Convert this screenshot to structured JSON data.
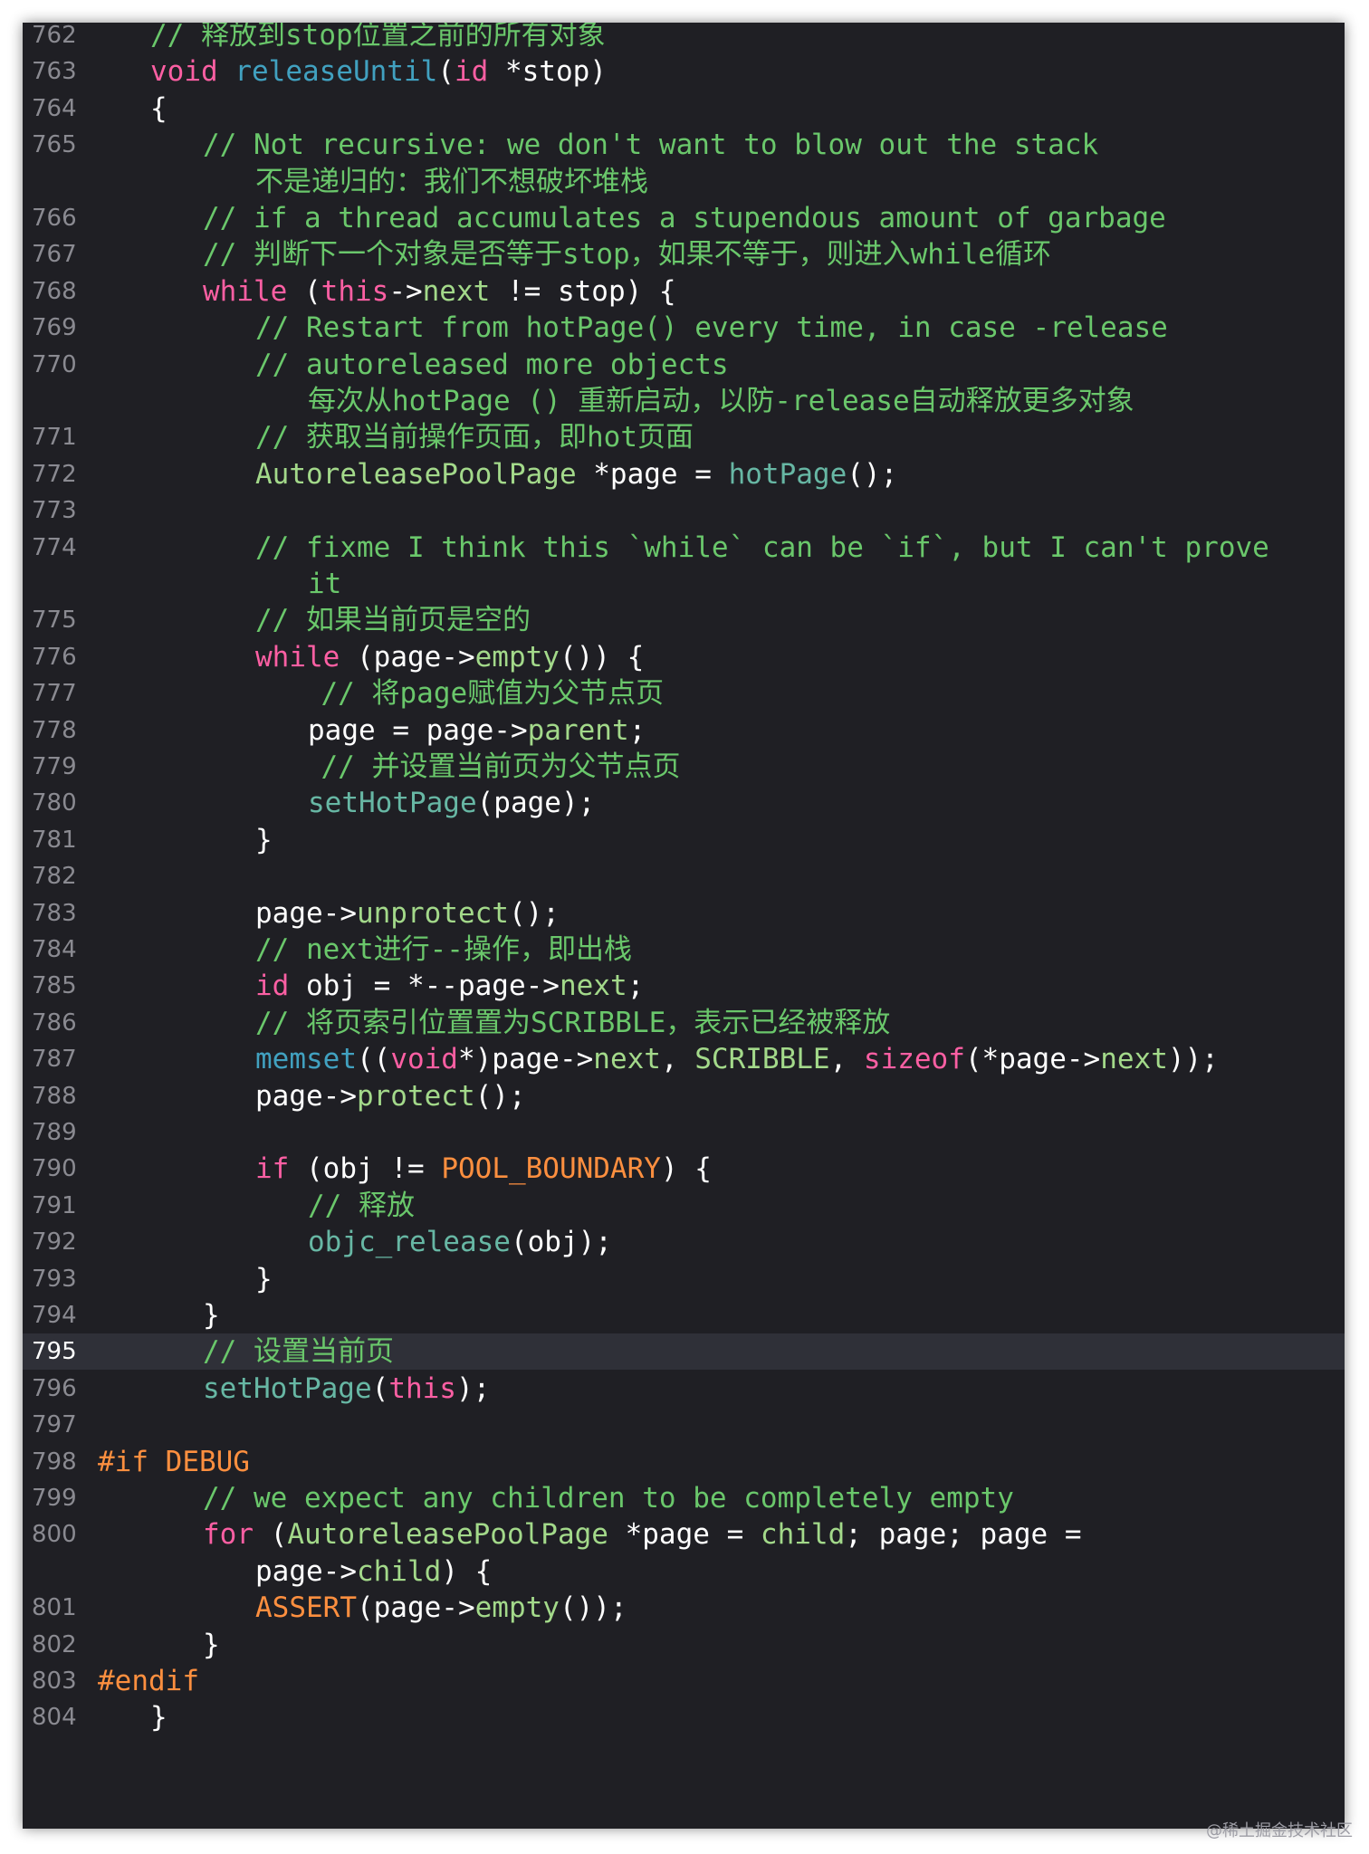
{
  "editor": {
    "current_line": "795",
    "watermark": "@稀土掘金技术社区"
  },
  "colors": {
    "background": "#1f1f24",
    "line_number": "#8a8a91",
    "current_line_bg": "#2f3038",
    "comment": "#6ac76b",
    "keyword": "#fc5fa3",
    "function": "#67b7a4",
    "type": "#a3d98a",
    "preprocessor": "#fd8f3f",
    "plain": "#ffffff"
  },
  "lines": [
    {
      "n": "762",
      "indent": 2,
      "tokens": [
        [
          "// 释放到stop位置之前的所有对象",
          "cm"
        ]
      ]
    },
    {
      "n": "763",
      "indent": 2,
      "tokens": [
        [
          "void",
          "kw"
        ],
        [
          " ",
          "tx"
        ],
        [
          "releaseUntil",
          "df"
        ],
        [
          "(",
          "tx"
        ],
        [
          "id",
          "kw"
        ],
        [
          " *stop)",
          "tx"
        ]
      ]
    },
    {
      "n": "764",
      "indent": 2,
      "tokens": [
        [
          "{",
          "tx"
        ]
      ]
    },
    {
      "n": "765",
      "indent": 4,
      "tokens": [
        [
          "// Not recursive: we don't want to blow out the stack",
          "cm"
        ]
      ]
    },
    {
      "n": "",
      "indent": 6,
      "tokens": [
        [
          "不是递归的：我们不想破坏堆栈",
          "cm"
        ]
      ]
    },
    {
      "n": "766",
      "indent": 4,
      "tokens": [
        [
          "// if a thread accumulates a stupendous amount of garbage",
          "cm"
        ]
      ]
    },
    {
      "n": "767",
      "indent": 4,
      "tokens": [
        [
          "// 判断下一个对象是否等于stop，如果不等于，则进入while循环",
          "cm"
        ]
      ]
    },
    {
      "n": "768",
      "indent": 4,
      "tokens": [
        [
          "while",
          "kw"
        ],
        [
          " (",
          "tx"
        ],
        [
          "this",
          "kw"
        ],
        [
          "->",
          "tx"
        ],
        [
          "next",
          "ty"
        ],
        [
          " != stop) {",
          "tx"
        ]
      ]
    },
    {
      "n": "769",
      "indent": 6,
      "tokens": [
        [
          "// Restart from hotPage() every time, in case -release",
          "cm"
        ]
      ]
    },
    {
      "n": "770",
      "indent": 6,
      "tokens": [
        [
          "// autoreleased more objects",
          "cm"
        ]
      ]
    },
    {
      "n": "",
      "indent": 8,
      "tokens": [
        [
          "每次从hotPage () 重新启动，以防-release自动释放更多对象",
          "cm"
        ]
      ]
    },
    {
      "n": "771",
      "indent": 6,
      "tokens": [
        [
          "// 获取当前操作页面，即hot页面",
          "cm"
        ]
      ]
    },
    {
      "n": "772",
      "indent": 6,
      "tokens": [
        [
          "AutoreleasePoolPage",
          "ty"
        ],
        [
          " *page = ",
          "tx"
        ],
        [
          "hotPage",
          "fn"
        ],
        [
          "();",
          "tx"
        ]
      ]
    },
    {
      "n": "773",
      "indent": 0,
      "tokens": []
    },
    {
      "n": "774",
      "indent": 6,
      "tokens": [
        [
          "// fixme I think this `while` can be `if`, but I can't prove",
          "cm"
        ]
      ]
    },
    {
      "n": "",
      "indent": 8,
      "tokens": [
        [
          "it",
          "cm"
        ]
      ]
    },
    {
      "n": "775",
      "indent": 6,
      "tokens": [
        [
          "// 如果当前页是空的",
          "cm"
        ]
      ]
    },
    {
      "n": "776",
      "indent": 6,
      "tokens": [
        [
          "while",
          "kw"
        ],
        [
          " (page->",
          "tx"
        ],
        [
          "empty",
          "ty"
        ],
        [
          "()) {",
          "tx"
        ]
      ]
    },
    {
      "n": "777",
      "indent": 8.5,
      "tokens": [
        [
          "// 将page赋值为父节点页",
          "cm"
        ]
      ]
    },
    {
      "n": "778",
      "indent": 8,
      "tokens": [
        [
          "page = page->",
          "tx"
        ],
        [
          "parent",
          "ty"
        ],
        [
          ";",
          "tx"
        ]
      ]
    },
    {
      "n": "779",
      "indent": 8.5,
      "tokens": [
        [
          "// 并设置当前页为父节点页",
          "cm"
        ]
      ]
    },
    {
      "n": "780",
      "indent": 8,
      "tokens": [
        [
          "setHotPage",
          "fn"
        ],
        [
          "(page);",
          "tx"
        ]
      ]
    },
    {
      "n": "781",
      "indent": 6,
      "tokens": [
        [
          "}",
          "tx"
        ]
      ]
    },
    {
      "n": "782",
      "indent": 0,
      "tokens": []
    },
    {
      "n": "783",
      "indent": 6,
      "tokens": [
        [
          "page->",
          "tx"
        ],
        [
          "unprotect",
          "ty"
        ],
        [
          "();",
          "tx"
        ]
      ]
    },
    {
      "n": "784",
      "indent": 6,
      "tokens": [
        [
          "// next进行--操作，即出栈",
          "cm"
        ]
      ]
    },
    {
      "n": "785",
      "indent": 6,
      "tokens": [
        [
          "id",
          "kw"
        ],
        [
          " obj = *--page->",
          "tx"
        ],
        [
          "next",
          "ty"
        ],
        [
          ";",
          "tx"
        ]
      ]
    },
    {
      "n": "786",
      "indent": 6,
      "tokens": [
        [
          "// 将页索引位置置为SCRIBBLE，表示已经被释放",
          "cm"
        ]
      ]
    },
    {
      "n": "787",
      "indent": 6,
      "tokens": [
        [
          "memset",
          "df"
        ],
        [
          "((",
          "tx"
        ],
        [
          "void",
          "kw"
        ],
        [
          "*)page->",
          "tx"
        ],
        [
          "next",
          "ty"
        ],
        [
          ", ",
          "tx"
        ],
        [
          "SCRIBBLE",
          "ty"
        ],
        [
          ", ",
          "tx"
        ],
        [
          "sizeof",
          "kw"
        ],
        [
          "(*page->",
          "tx"
        ],
        [
          "next",
          "ty"
        ],
        [
          "));",
          "tx"
        ]
      ]
    },
    {
      "n": "788",
      "indent": 6,
      "tokens": [
        [
          "page->",
          "tx"
        ],
        [
          "protect",
          "ty"
        ],
        [
          "();",
          "tx"
        ]
      ]
    },
    {
      "n": "789",
      "indent": 0,
      "tokens": []
    },
    {
      "n": "790",
      "indent": 6,
      "tokens": [
        [
          "if",
          "kw"
        ],
        [
          " (obj != ",
          "tx"
        ],
        [
          "POOL_BOUNDARY",
          "mc"
        ],
        [
          ") {",
          "tx"
        ]
      ]
    },
    {
      "n": "791",
      "indent": 8,
      "tokens": [
        [
          "// 释放",
          "cm"
        ]
      ]
    },
    {
      "n": "792",
      "indent": 8,
      "tokens": [
        [
          "objc_release",
          "fn"
        ],
        [
          "(obj);",
          "tx"
        ]
      ]
    },
    {
      "n": "793",
      "indent": 6,
      "tokens": [
        [
          "}",
          "tx"
        ]
      ]
    },
    {
      "n": "794",
      "indent": 4,
      "tokens": [
        [
          "}",
          "tx"
        ]
      ]
    },
    {
      "n": "795",
      "indent": 4,
      "tokens": [
        [
          "// 设置当前页",
          "cm"
        ]
      ]
    },
    {
      "n": "796",
      "indent": 4,
      "tokens": [
        [
          "setHotPage",
          "fn"
        ],
        [
          "(",
          "tx"
        ],
        [
          "this",
          "kw"
        ],
        [
          ");",
          "tx"
        ]
      ]
    },
    {
      "n": "797",
      "indent": 0,
      "tokens": []
    },
    {
      "n": "798",
      "indent": 0,
      "tokens": [
        [
          "#if DEBUG",
          "pp"
        ]
      ]
    },
    {
      "n": "799",
      "indent": 4,
      "tokens": [
        [
          "// we expect any children to be completely empty",
          "cm"
        ]
      ]
    },
    {
      "n": "800",
      "indent": 4,
      "tokens": [
        [
          "for",
          "kw"
        ],
        [
          " (",
          "tx"
        ],
        [
          "AutoreleasePoolPage",
          "ty"
        ],
        [
          " *page = ",
          "tx"
        ],
        [
          "child",
          "ty"
        ],
        [
          "; page; page =",
          "tx"
        ]
      ]
    },
    {
      "n": "",
      "indent": 6,
      "tokens": [
        [
          "page->",
          "tx"
        ],
        [
          "child",
          "ty"
        ],
        [
          ") {",
          "tx"
        ]
      ]
    },
    {
      "n": "801",
      "indent": 6,
      "tokens": [
        [
          "ASSERT",
          "mc"
        ],
        [
          "(page->",
          "tx"
        ],
        [
          "empty",
          "ty"
        ],
        [
          "());",
          "tx"
        ]
      ]
    },
    {
      "n": "802",
      "indent": 4,
      "tokens": [
        [
          "}",
          "tx"
        ]
      ]
    },
    {
      "n": "803",
      "indent": 0,
      "tokens": [
        [
          "#endif",
          "pp"
        ]
      ]
    },
    {
      "n": "804",
      "indent": 2,
      "tokens": [
        [
          "}",
          "tx"
        ]
      ]
    }
  ]
}
